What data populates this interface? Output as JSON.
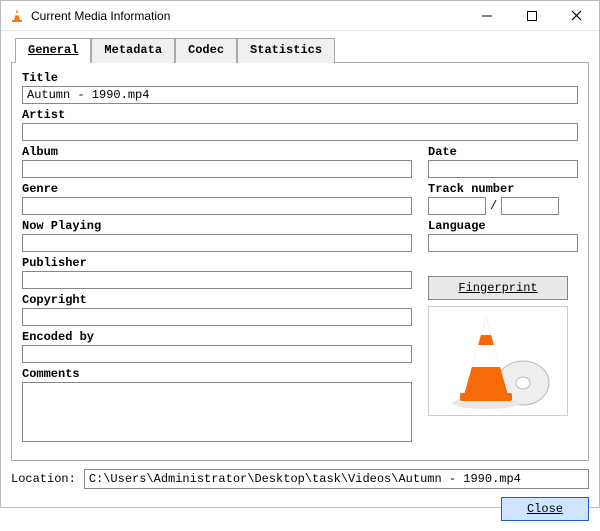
{
  "window": {
    "title": "Current Media Information"
  },
  "tabs": {
    "general": "General",
    "metadata": "Metadata",
    "codec": "Codec",
    "statistics": "Statistics"
  },
  "labels": {
    "title": "Title",
    "artist": "Artist",
    "album": "Album",
    "genre": "Genre",
    "date": "Date",
    "track_number": "Track number",
    "now_playing": "Now Playing",
    "language": "Language",
    "publisher": "Publisher",
    "copyright": "Copyright",
    "encoded_by": "Encoded by",
    "comments": "Comments",
    "fingerprint": "Fingerprint",
    "location": "Location:",
    "close": "Close",
    "track_sep": "/"
  },
  "values": {
    "title": "Autumn - 1990.mp4",
    "artist": "",
    "album": "",
    "genre": "",
    "date": "",
    "track_a": "",
    "track_b": "",
    "now_playing": "",
    "language": "",
    "publisher": "",
    "copyright": "",
    "encoded_by": "",
    "comments": "",
    "location": "C:\\Users\\Administrator\\Desktop\\task\\Videos\\Autumn - 1990.mp4"
  }
}
